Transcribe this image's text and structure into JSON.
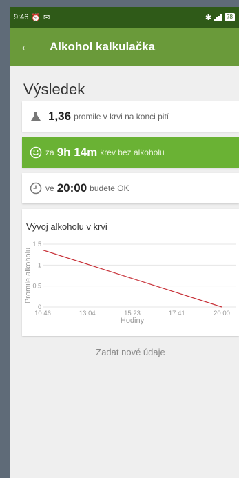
{
  "status": {
    "time": "9:46",
    "battery": "78"
  },
  "appbar": {
    "title": "Alkohol kalkulačka"
  },
  "result": {
    "title": "Výsledek",
    "card1": {
      "value": "1,36",
      "text": "promile v krvi na konci pití"
    },
    "card2": {
      "prefix": "za",
      "value": "9h 14m",
      "text": "krev bez alkoholu"
    },
    "card3": {
      "prefix": "ve",
      "value": "20:00",
      "text": "budete OK"
    }
  },
  "chart_data": {
    "type": "line",
    "title": "Vývoj alkoholu v krvi",
    "xlabel": "Hodiny",
    "ylabel": "Promile alkoholu",
    "x_ticks": [
      "10:46",
      "13:04",
      "15:23",
      "17:41",
      "20:00"
    ],
    "y_ticks": [
      "0",
      "0.5",
      "1",
      "1.5"
    ],
    "ylim": [
      0,
      1.5
    ],
    "series": [
      {
        "x": [
          "10:46",
          "20:00"
        ],
        "values": [
          1.36,
          0
        ]
      }
    ],
    "color": "#c8333a"
  },
  "link": {
    "label": "Zadat nové údaje"
  }
}
